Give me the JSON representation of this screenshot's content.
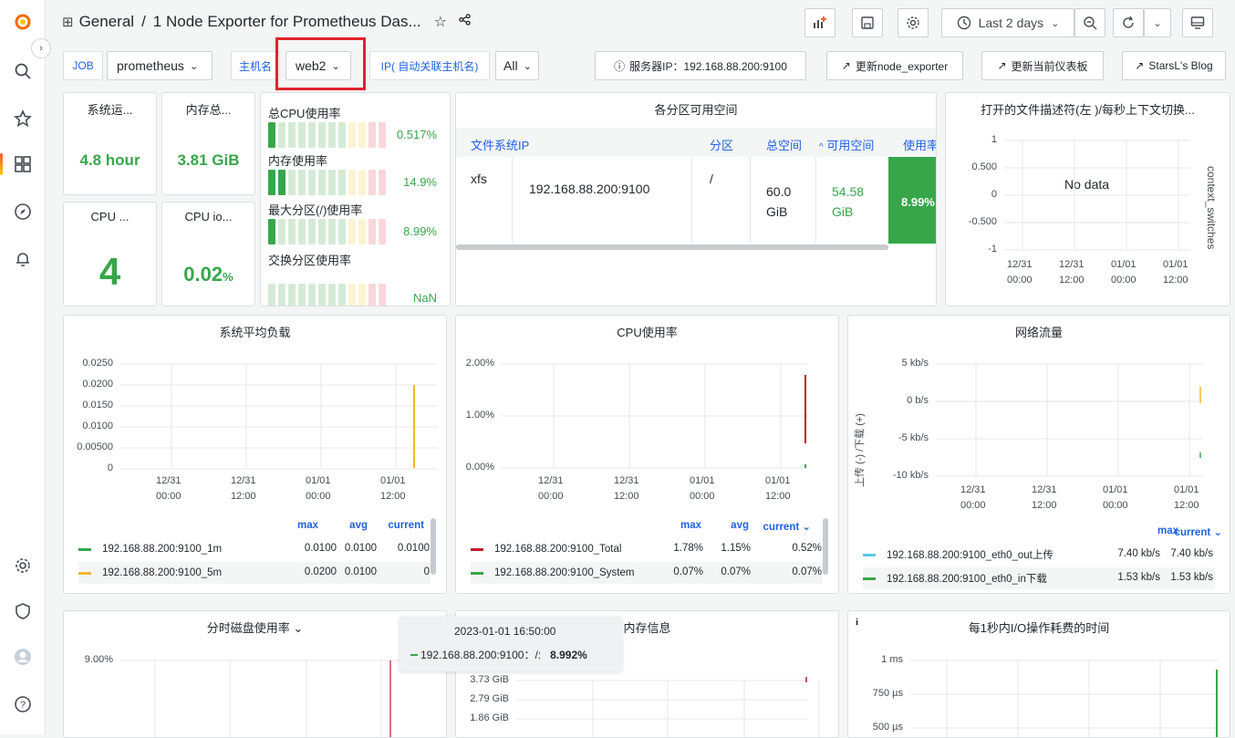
{
  "colors": {
    "green": "#37a64a",
    "blue": "#1f62e0",
    "red": "#c4162a",
    "yellow": "#f2b72f",
    "highlight": "#e0232b"
  },
  "sidebar": {
    "icons": [
      "grafana-logo-icon",
      "search-icon",
      "star-icon",
      "dashboards-icon",
      "explore-icon",
      "alerting-icon",
      "settings-icon",
      "shield-icon",
      "user-avatar-icon",
      "help-icon"
    ]
  },
  "topnav": {
    "folder": "General",
    "separator": "/",
    "title": "1 Node Exporter for Prometheus Das...",
    "time_range": "Last 2 days"
  },
  "variables": {
    "job_label": "JOB",
    "job_value": "prometheus",
    "host_label": "主机名",
    "host_value": "web2",
    "ip_label": "IP( 自动关联主机名)",
    "ip_value": "All",
    "server_ip": "服务器IP：192.168.88.200:9100",
    "links": [
      "更新node_exporter",
      "更新当前仪表板",
      "StarsL's Blog"
    ]
  },
  "stats": {
    "uptime": {
      "title": "系统运...",
      "value": "4.8 hour"
    },
    "memory": {
      "title": "内存总...",
      "value": "3.81 GiB"
    },
    "cpu_cores": {
      "title": "CPU ...",
      "value": "4"
    },
    "cpu_iowait": {
      "title": "CPU io...",
      "value": "0.02",
      "unit": "%"
    }
  },
  "bargauges": [
    {
      "title": "总CPU使用率",
      "value": "0.517%",
      "fill": 0.005
    },
    {
      "title": "内存使用率",
      "value": "14.9%",
      "fill": 0.149
    },
    {
      "title": "最大分区(/)使用率",
      "value": "8.99%",
      "fill": 0.09
    },
    {
      "title": "交换分区使用率",
      "value": "NaN",
      "fill": 0
    }
  ],
  "fs_table": {
    "title": "各分区可用空间",
    "headers": [
      "文件系统",
      "IP",
      "分区",
      "总空间",
      "可用空间",
      "使用率"
    ],
    "row": [
      "xfs",
      "192.168.88.200:9100",
      "/",
      "60.0 GiB",
      "54.58 GiB",
      "8.99%"
    ]
  },
  "fd_panel": {
    "title": "打开的文件描述符(左 )/每秒上下文切换...",
    "nodata": "No data",
    "right_axis": "context_switches",
    "yticks": [
      "1",
      "0.500",
      "0",
      "-0.500",
      "-1"
    ],
    "xticks": [
      [
        "12/31",
        "00:00"
      ],
      [
        "12/31",
        "12:00"
      ],
      [
        "01/01",
        "00:00"
      ],
      [
        "01/01",
        "12:00"
      ]
    ]
  },
  "load_panel": {
    "title": "系统平均负载",
    "yticks": [
      "0.0250",
      "0.0200",
      "0.0150",
      "0.0100",
      "0.00500",
      "0"
    ],
    "xticks": [
      [
        "12/31",
        "00:00"
      ],
      [
        "12/31",
        "12:00"
      ],
      [
        "01/01",
        "00:00"
      ],
      [
        "01/01",
        "12:00"
      ]
    ],
    "legend_headers": [
      "max",
      "avg",
      "current"
    ],
    "legend": [
      {
        "name": "192.168.88.200:9100_1m",
        "max": "0.0100",
        "avg": "0.0100",
        "current": "0.0100"
      },
      {
        "name": "192.168.88.200:9100_5m",
        "max": "0.0200",
        "avg": "0.0100",
        "current": "0"
      }
    ]
  },
  "cpu_panel": {
    "title": "CPU使用率",
    "yticks": [
      "2.00%",
      "1.00%",
      "0.00%"
    ],
    "xticks": [
      [
        "12/31",
        "00:00"
      ],
      [
        "12/31",
        "12:00"
      ],
      [
        "01/01",
        "00:00"
      ],
      [
        "01/01",
        "12:00"
      ]
    ],
    "legend_headers": [
      "max",
      "avg",
      "current ⌄"
    ],
    "legend": [
      {
        "name": "192.168.88.200:9100_Total",
        "max": "1.78%",
        "avg": "1.15%",
        "current": "0.52%"
      },
      {
        "name": "192.168.88.200:9100_System",
        "max": "0.07%",
        "avg": "0.07%",
        "current": "0.07%"
      }
    ]
  },
  "net_panel": {
    "title": "网络流量",
    "ylabel": "上传 (-) /下载 (+)",
    "yticks": [
      "5 kb/s",
      "0 b/s",
      "-5 kb/s",
      "-10 kb/s"
    ],
    "xticks": [
      [
        "12/31",
        "00:00"
      ],
      [
        "12/31",
        "12:00"
      ],
      [
        "01/01",
        "00:00"
      ],
      [
        "01/01",
        "12:00"
      ]
    ],
    "legend_headers": [
      "max",
      "current ⌄"
    ],
    "legend": [
      {
        "name": "192.168.88.200:9100_eth0_out上传",
        "max": "7.40 kb/s",
        "current": "7.40 kb/s"
      },
      {
        "name": "192.168.88.200:9100_eth0_in下载",
        "max": "1.53 kb/s",
        "current": "1.53 kb/s"
      }
    ]
  },
  "disk_panel": {
    "title": "分时磁盘使用率 ⌄",
    "ytick": "9.00%"
  },
  "mem_panel": {
    "title": "内存信息",
    "yticks": [
      "3.73 GiB",
      "2.79 GiB",
      "1.86 GiB"
    ]
  },
  "io_panel": {
    "title": "每1秒内I/O操作耗费的时间",
    "info": "i",
    "yticks": [
      "1 ms",
      "750 µs",
      "500 µs"
    ]
  },
  "tooltip": {
    "time": "2023-01-01 16:50:00",
    "series": "192.168.88.200:9100：/:",
    "value": "8.992%"
  }
}
